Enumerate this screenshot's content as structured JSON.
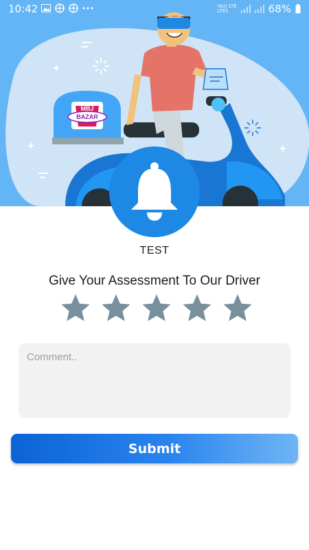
{
  "status_bar": {
    "time": "10:42",
    "network_top": "Vo)) LTE",
    "network_bottom": "LTE1",
    "battery": "68%"
  },
  "hero": {
    "brand_top": "MBJ",
    "brand_bottom": "BAZAR"
  },
  "notification": {
    "title": "TEST"
  },
  "rating": {
    "prompt": "Give Your Assessment To Our Driver",
    "star_count": 5,
    "selected": 0
  },
  "comment": {
    "placeholder": "Comment..",
    "value": ""
  },
  "submit": {
    "label": "Submit"
  },
  "colors": {
    "hero_bg": "#64b5f6",
    "accent": "#1e88e5",
    "star": "#78909c",
    "button_start": "#0b63d6",
    "button_end": "#6fb5f5"
  }
}
